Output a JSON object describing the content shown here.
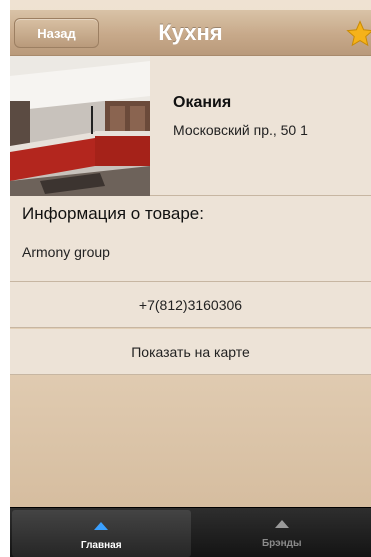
{
  "navbar": {
    "back_label": "Назад",
    "title": "Кухня",
    "favorite_icon": "star-icon"
  },
  "store": {
    "name": "Окания",
    "address": "Московский пр., 50 1"
  },
  "info": {
    "heading": "Информация о товаре:",
    "brand": "Armony group"
  },
  "actions": {
    "phone": "+7(812)3160306",
    "map": "Показать на карте"
  },
  "tabbar": {
    "tabs": [
      {
        "label": "Главная",
        "icon": "home-arrow-icon",
        "active": true
      },
      {
        "label": "Брэнды",
        "icon": "brands-arrow-icon",
        "active": false
      }
    ]
  },
  "colors": {
    "navbar": "#c7a98a",
    "background": "#ede3d7",
    "tabbar": "#141414",
    "active_tab_icon": "#3aa0ff"
  }
}
